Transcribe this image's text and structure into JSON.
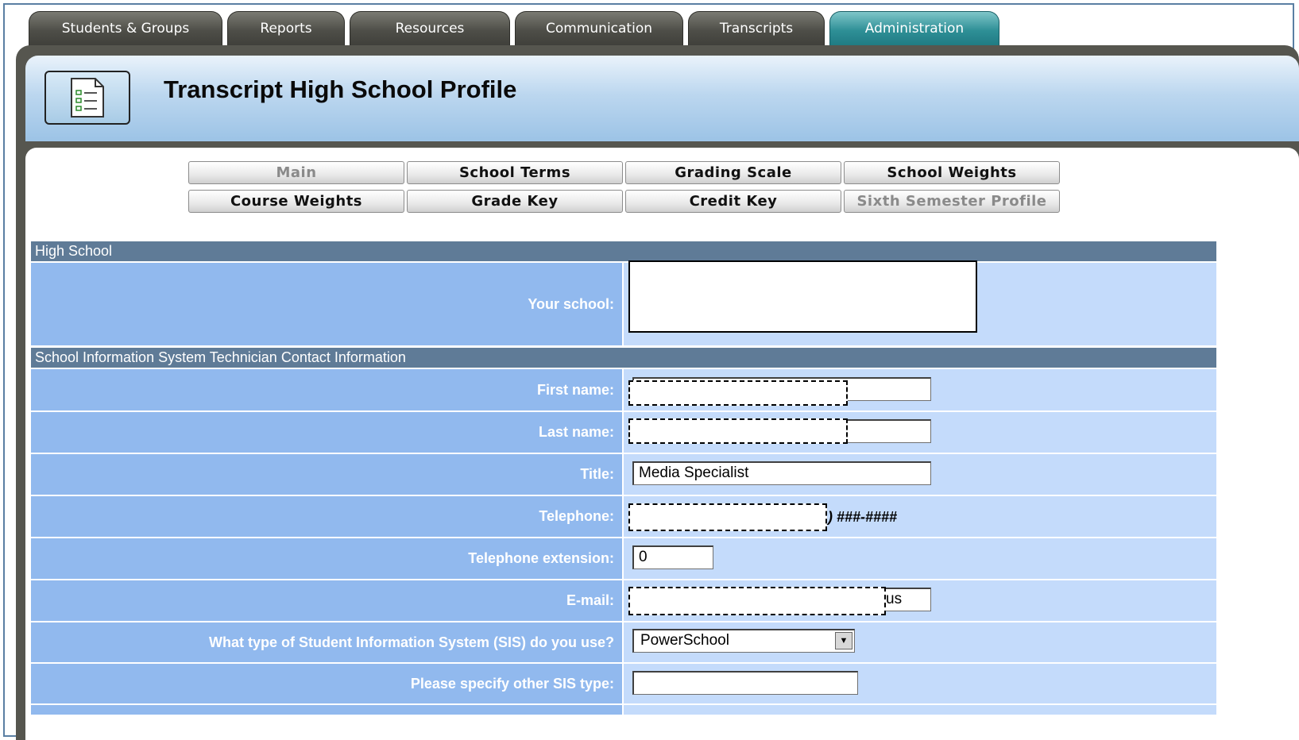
{
  "tabs": [
    {
      "label": "Students & Groups",
      "active": false
    },
    {
      "label": "Reports",
      "active": false
    },
    {
      "label": "Resources",
      "active": false
    },
    {
      "label": "Communication",
      "active": false
    },
    {
      "label": "Transcripts",
      "active": false
    },
    {
      "label": "Administration",
      "active": true
    }
  ],
  "header": {
    "title": "Transcript High School Profile",
    "icon": "checklist-document-icon"
  },
  "subnav": [
    {
      "label": "Main",
      "disabled": true
    },
    {
      "label": "School Terms",
      "disabled": false
    },
    {
      "label": "Grading Scale",
      "disabled": false
    },
    {
      "label": "School Weights",
      "disabled": false
    },
    {
      "label": "Course Weights",
      "disabled": false
    },
    {
      "label": "Grade Key",
      "disabled": false
    },
    {
      "label": "Credit Key",
      "disabled": false
    },
    {
      "label": "Sixth Semester Profile",
      "disabled": true
    }
  ],
  "sections": {
    "high_school": {
      "title": "High School"
    },
    "contact": {
      "title": "School Information System Technician Contact Information"
    }
  },
  "fields": {
    "your_school": {
      "label": "Your school:",
      "value": ""
    },
    "first_name": {
      "label": "First name:",
      "value": ""
    },
    "last_name": {
      "label": "Last name:",
      "value": ""
    },
    "title": {
      "label": "Title:",
      "value": "Media Specialist"
    },
    "telephone": {
      "label": "Telephone:",
      "value": "",
      "suffix": ") ###-####"
    },
    "telephone_extension": {
      "label": "Telephone extension:",
      "value": "0"
    },
    "email": {
      "label": "E-mail:",
      "value": "us"
    },
    "sis_type": {
      "label": "What type of Student Information System (SIS) do you use?",
      "value": "PowerSchool"
    },
    "other_sis": {
      "label": "Please specify other SIS type:",
      "value": ""
    }
  },
  "colors": {
    "active_tab": "#2e8f96",
    "section_header": "#5f7b97",
    "label_cell": "#91b9ee",
    "value_cell": "#c4dbfb"
  }
}
